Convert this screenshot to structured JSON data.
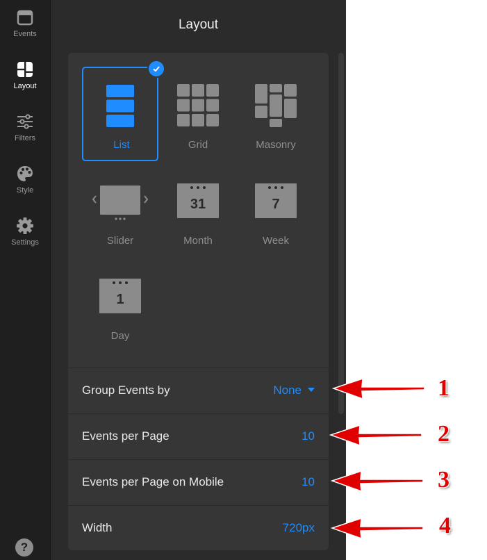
{
  "nav": {
    "items": [
      {
        "label": "Events",
        "icon": "calendar-icon"
      },
      {
        "label": "Layout",
        "icon": "layout-icon"
      },
      {
        "label": "Filters",
        "icon": "sliders-icon"
      },
      {
        "label": "Style",
        "icon": "palette-icon"
      },
      {
        "label": "Settings",
        "icon": "gear-icon"
      }
    ],
    "help": "?"
  },
  "panel": {
    "title": "Layout",
    "layouts": [
      {
        "label": "List",
        "icon": "list-layout-icon",
        "selected": true
      },
      {
        "label": "Grid",
        "icon": "grid-layout-icon"
      },
      {
        "label": "Masonry",
        "icon": "masonry-layout-icon"
      },
      {
        "label": "Slider",
        "icon": "slider-layout-icon"
      },
      {
        "label": "Month",
        "icon": "month-calendar-icon",
        "glyph": "31"
      },
      {
        "label": "Week",
        "icon": "week-calendar-icon",
        "glyph": "7"
      },
      {
        "label": "Day",
        "icon": "day-calendar-icon",
        "glyph": "1"
      }
    ],
    "settings": [
      {
        "label": "Group Events by",
        "value": "None"
      },
      {
        "label": "Events per Page",
        "value": "10"
      },
      {
        "label": "Events per Page on Mobile",
        "value": "10"
      },
      {
        "label": "Width",
        "value": "720px"
      }
    ]
  },
  "annotations": [
    "1",
    "2",
    "3",
    "4"
  ],
  "colors": {
    "accent": "#1f8cff",
    "annotation": "#e00000"
  }
}
